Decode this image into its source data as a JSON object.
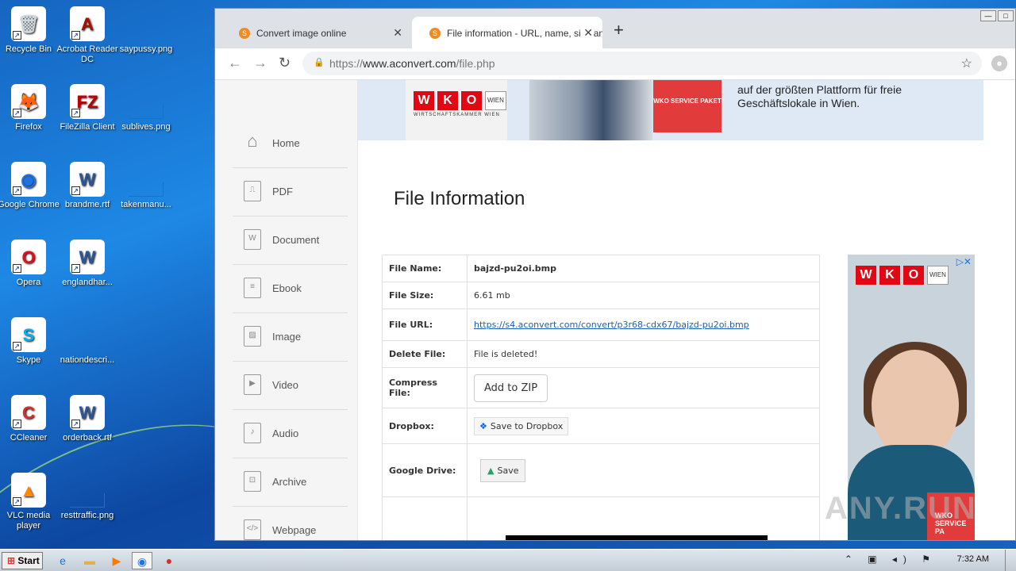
{
  "desktop": {
    "icons": [
      {
        "label": "Recycle Bin",
        "glyph": "🗑",
        "color": "#cfd8dc"
      },
      {
        "label": "Acrobat Reader DC",
        "glyph": "A",
        "color": "#b30b00"
      },
      {
        "label": "saypussy.png",
        "glyph": "",
        "color": "transparent"
      },
      {
        "label": "Firefox",
        "glyph": "🦊",
        "color": "#ff7139"
      },
      {
        "label": "FileZilla Client",
        "glyph": "FZ",
        "color": "#bf0000"
      },
      {
        "label": "sublives.png",
        "glyph": "",
        "color": "transparent"
      },
      {
        "label": "Google Chrome",
        "glyph": "◉",
        "color": "#1a73e8"
      },
      {
        "label": "brandme.rtf",
        "glyph": "W",
        "color": "#2b579a"
      },
      {
        "label": "takenmanu...",
        "glyph": "",
        "color": "transparent"
      },
      {
        "label": "Opera",
        "glyph": "O",
        "color": "#e0101e"
      },
      {
        "label": "englandhar...",
        "glyph": "W",
        "color": "#2b579a"
      },
      {
        "label": "Skype",
        "glyph": "S",
        "color": "#00aff0"
      },
      {
        "label": "nationdescri...",
        "glyph": "",
        "color": "transparent"
      },
      {
        "label": "CCleaner",
        "glyph": "C",
        "color": "#d32f2f"
      },
      {
        "label": "orderback.rtf",
        "glyph": "W",
        "color": "#2b579a"
      },
      {
        "label": "VLC media player",
        "glyph": "▲",
        "color": "#ff8800"
      },
      {
        "label": "resttraffic.png",
        "glyph": "",
        "color": "transparent"
      }
    ]
  },
  "browser": {
    "tabs": [
      {
        "title": "Convert image online",
        "active": false
      },
      {
        "title": "File information - URL, name, size and",
        "active": true
      }
    ],
    "new_tab": "+",
    "url_scheme": "https://",
    "url_host": "www.aconvert.com",
    "url_path": "/file.php"
  },
  "sidebar": {
    "items": [
      {
        "label": "Home",
        "icon": "home-icon",
        "glyph": "⌂"
      },
      {
        "label": "PDF",
        "icon": "pdf-icon",
        "glyph": "⎍"
      },
      {
        "label": "Document",
        "icon": "document-icon",
        "glyph": "W"
      },
      {
        "label": "Ebook",
        "icon": "ebook-icon",
        "glyph": "≡"
      },
      {
        "label": "Image",
        "icon": "image-icon",
        "glyph": "▨"
      },
      {
        "label": "Video",
        "icon": "video-icon",
        "glyph": "▶"
      },
      {
        "label": "Audio",
        "icon": "audio-icon",
        "glyph": "♪"
      },
      {
        "label": "Archive",
        "icon": "archive-icon",
        "glyph": "⊡"
      },
      {
        "label": "Webpage",
        "icon": "webpage-icon",
        "glyph": "</>"
      }
    ]
  },
  "banner": {
    "logo_letters": [
      "W",
      "K",
      "O"
    ],
    "logo_badge": "WIEN",
    "logo_sub": "WIRTSCHAFTSKAMMER WIEN",
    "box_text": "WKO SERVICE PAKET",
    "line1": "auf der größten Plattform für freie",
    "line2": "Geschäftslokale in Wien."
  },
  "main": {
    "title": "File Information",
    "rows": {
      "name_label": "File Name:",
      "name_value": "bajzd-pu2oi.bmp",
      "size_label": "File Size:",
      "size_value": "6.61 mb",
      "url_label": "File URL:",
      "url_value": "https://s4.aconvert.com/convert/p3r68-cdx67/bajzd-pu2oi.bmp",
      "delete_label": "Delete File:",
      "delete_value": "File is deleted!",
      "compress_label": "Compress File:",
      "compress_button": "Add to ZIP",
      "dropbox_label": "Dropbox:",
      "dropbox_button": "Save to Dropbox",
      "gdrive_label": "Google Drive:",
      "gdrive_button": "Save"
    }
  },
  "side_ad": {
    "badge": "WIEN",
    "ad_choices": "▷✕",
    "box_text": "WKO SERVICE PA"
  },
  "watermark": "ANY.RUN",
  "taskbar": {
    "start": "Start",
    "clock": "7:32 AM"
  }
}
